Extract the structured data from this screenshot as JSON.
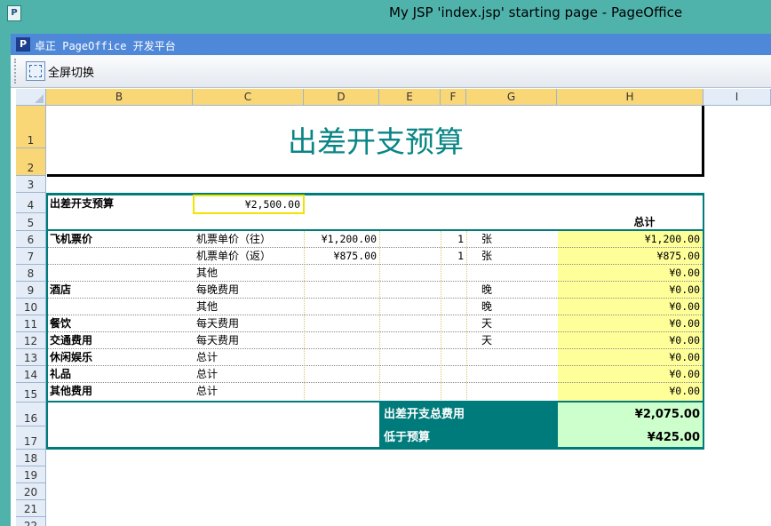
{
  "window": {
    "title": "My JSP 'index.jsp' starting page - PageOffice"
  },
  "app": {
    "title": "卓正 PageOffice 开发平台",
    "toolbar": {
      "fullscreen_label": "全屏切换"
    }
  },
  "sheet": {
    "columns": [
      "B",
      "C",
      "D",
      "E",
      "F",
      "G",
      "H",
      "I"
    ],
    "rows": [
      "1",
      "2",
      "3",
      "4",
      "5",
      "6",
      "7",
      "8",
      "9",
      "10",
      "11",
      "12",
      "13",
      "14",
      "15",
      "16",
      "17",
      "18",
      "19",
      "20",
      "21",
      "22"
    ],
    "title": "出差开支预算",
    "budget_label": "出差开支预算",
    "budget_value": "¥2,500.00",
    "total_header": "总计",
    "lines": [
      {
        "category": "飞机票价",
        "item": "机票单价（往）",
        "price": "¥1,200.00",
        "qty": "1",
        "unit": "张",
        "total": "¥1,200.00"
      },
      {
        "category": "",
        "item": "机票单价（返）",
        "price": "¥875.00",
        "qty": "1",
        "unit": "张",
        "total": "¥875.00"
      },
      {
        "category": "",
        "item": "其他",
        "price": "",
        "qty": "",
        "unit": "",
        "total": "¥0.00"
      },
      {
        "category": "酒店",
        "item": "每晚费用",
        "price": "",
        "qty": "",
        "unit": "晚",
        "total": "¥0.00"
      },
      {
        "category": "",
        "item": "其他",
        "price": "",
        "qty": "",
        "unit": "晚",
        "total": "¥0.00"
      },
      {
        "category": "餐饮",
        "item": "每天费用",
        "price": "",
        "qty": "",
        "unit": "天",
        "total": "¥0.00"
      },
      {
        "category": "交通费用",
        "item": "每天费用",
        "price": "",
        "qty": "",
        "unit": "天",
        "total": "¥0.00"
      },
      {
        "category": "休闲娱乐",
        "item": "总计",
        "price": "",
        "qty": "",
        "unit": "",
        "total": "¥0.00"
      },
      {
        "category": "礼品",
        "item": "总计",
        "price": "",
        "qty": "",
        "unit": "",
        "total": "¥0.00"
      },
      {
        "category": "其他费用",
        "item": "总计",
        "price": "",
        "qty": "",
        "unit": "",
        "total": "¥0.00"
      }
    ],
    "summary": [
      {
        "label": "出差开支总费用",
        "value": "¥2,075.00"
      },
      {
        "label": "低于预算",
        "value": "¥425.00"
      }
    ]
  }
}
